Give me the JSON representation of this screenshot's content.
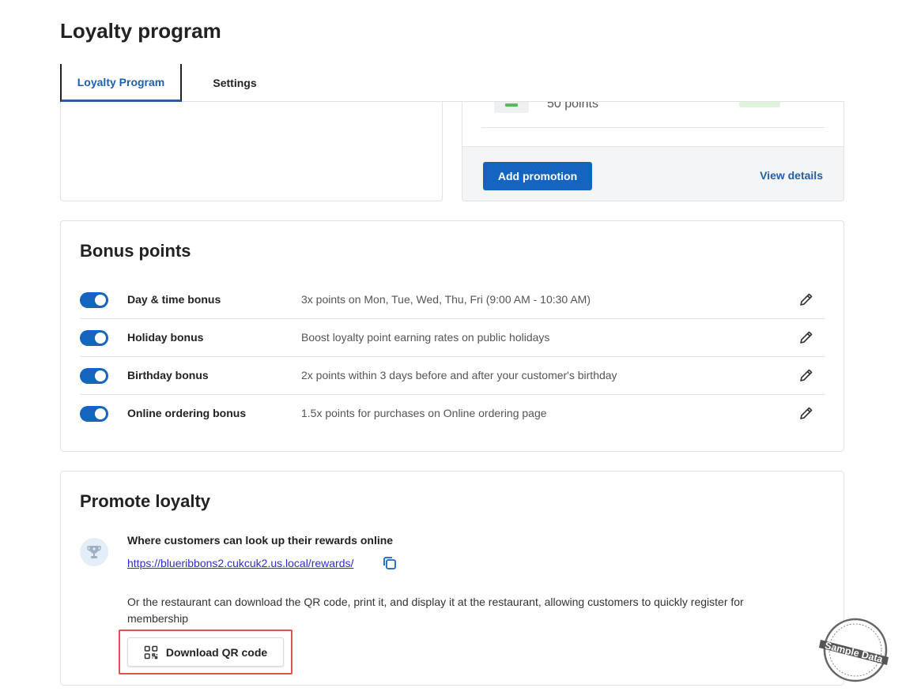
{
  "page": {
    "title": "Loyalty program"
  },
  "tabs": [
    {
      "label": "Loyalty Program",
      "active": true
    },
    {
      "label": "Settings",
      "active": false
    }
  ],
  "promotion_card": {
    "item_points": "50 points",
    "add_button": "Add promotion",
    "view_link": "View details"
  },
  "bonus_points": {
    "title": "Bonus points",
    "items": [
      {
        "name": "Day & time bonus",
        "description": "3x points on Mon, Tue, Wed, Thu, Fri (9:00 AM - 10:30 AM)",
        "enabled": true
      },
      {
        "name": "Holiday bonus",
        "description": "Boost loyalty point earning rates on public holidays",
        "enabled": true
      },
      {
        "name": "Birthday bonus",
        "description": "2x points within 3 days before and after your customer's birthday",
        "enabled": true
      },
      {
        "name": "Online ordering bonus",
        "description": "1.5x points for purchases on Online ordering page",
        "enabled": true
      }
    ]
  },
  "promote": {
    "title": "Promote loyalty",
    "heading": "Where customers can look up their rewards online",
    "link": "https://blueribbons2.cukcuk2.us.local/rewards/",
    "description": "Or the restaurant can download the QR code, print it, and display it at the restaurant, allowing customers to quickly register for membership",
    "qr_button": "Download QR code"
  },
  "watermark": {
    "text": "Sample Data"
  },
  "colors": {
    "primary": "#1565c0",
    "link": "#1f5faa",
    "highlight": "#e05252"
  }
}
